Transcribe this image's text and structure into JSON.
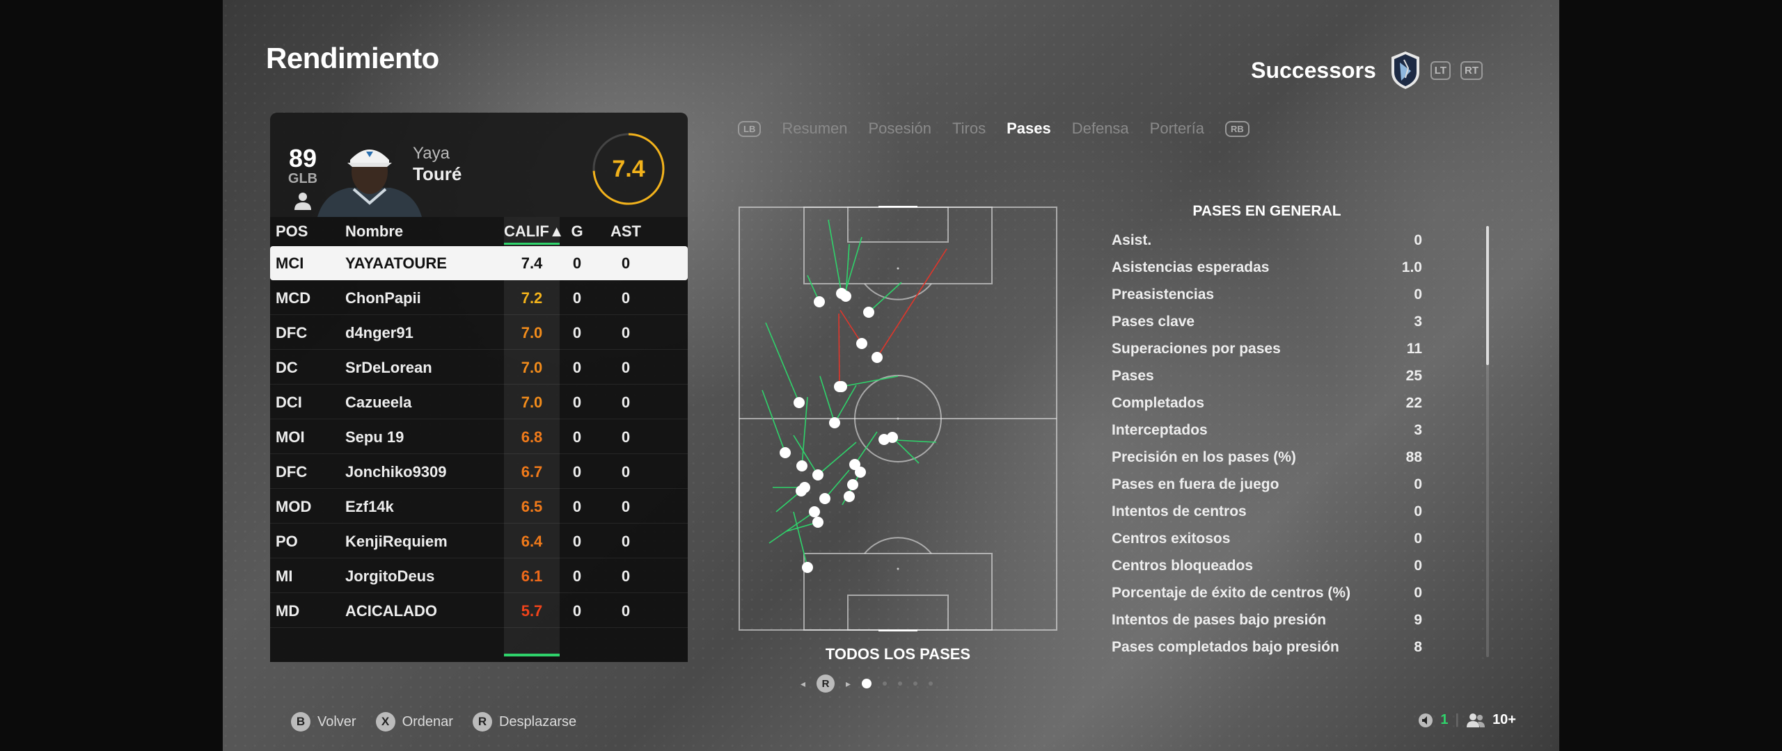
{
  "page": {
    "title": "Rendimiento"
  },
  "team": {
    "name": "Successors",
    "lt": "LT",
    "rt": "RT"
  },
  "player": {
    "overall": "89",
    "position": "GLB",
    "first_name": "Yaya",
    "last_name": "Touré",
    "rating": "7.4",
    "rating_fraction": 0.74
  },
  "table": {
    "headers": {
      "pos": "POS",
      "name": "Nombre",
      "calif": "CALIF▲",
      "g": "G",
      "ast": "AST"
    },
    "rows": [
      {
        "pos": "MCI",
        "name": "YAYAATOURE",
        "calif": "7.4",
        "g": "0",
        "ast": "0",
        "color": "#111111"
      },
      {
        "pos": "MCD",
        "name": "ChonPapii",
        "calif": "7.2",
        "g": "0",
        "ast": "0",
        "color": "#f2b21b"
      },
      {
        "pos": "DFC",
        "name": "d4nger91",
        "calif": "7.0",
        "g": "0",
        "ast": "0",
        "color": "#f28c1b"
      },
      {
        "pos": "DC",
        "name": "SrDeLorean",
        "calif": "7.0",
        "g": "0",
        "ast": "0",
        "color": "#f28c1b"
      },
      {
        "pos": "DCI",
        "name": "Cazueela",
        "calif": "7.0",
        "g": "0",
        "ast": "0",
        "color": "#f28c1b"
      },
      {
        "pos": "MOI",
        "name": "Sepu 19",
        "calif": "6.8",
        "g": "0",
        "ast": "0",
        "color": "#f07a1a"
      },
      {
        "pos": "DFC",
        "name": "Jonchiko9309",
        "calif": "6.7",
        "g": "0",
        "ast": "0",
        "color": "#f07a1a"
      },
      {
        "pos": "MOD",
        "name": "Ezf14k",
        "calif": "6.5",
        "g": "0",
        "ast": "0",
        "color": "#f07a1a"
      },
      {
        "pos": "PO",
        "name": "KenjiRequiem",
        "calif": "6.4",
        "g": "0",
        "ast": "0",
        "color": "#f07a1a"
      },
      {
        "pos": "MI",
        "name": "JorgitoDeus",
        "calif": "6.1",
        "g": "0",
        "ast": "0",
        "color": "#f06a1a"
      },
      {
        "pos": "MD",
        "name": "ACICALADO",
        "calif": "5.7",
        "g": "0",
        "ast": "0",
        "color": "#f0431a"
      }
    ]
  },
  "tabs": {
    "lb": "LB",
    "rb": "RB",
    "items": [
      "Resumen",
      "Posesión",
      "Tiros",
      "Pases",
      "Defensa",
      "Portería"
    ],
    "active_index": 3
  },
  "pitch": {
    "caption": "TODOS LOS PASES",
    "page_button": "R"
  },
  "stats": {
    "title": "PASES EN GENERAL",
    "items": [
      {
        "label": "Asist.",
        "value": "0"
      },
      {
        "label": "Asistencias esperadas",
        "value": "1.0"
      },
      {
        "label": "Preasistencias",
        "value": "0"
      },
      {
        "label": "Pases clave",
        "value": "3"
      },
      {
        "label": "Superaciones por pases",
        "value": "11"
      },
      {
        "label": "Pases",
        "value": "25"
      },
      {
        "label": "Completados",
        "value": "22"
      },
      {
        "label": "Interceptados",
        "value": "3"
      },
      {
        "label": "Precisión en los pases (%)",
        "value": "88"
      },
      {
        "label": "Pases en fuera de juego",
        "value": "0"
      },
      {
        "label": "Intentos de centros",
        "value": "0"
      },
      {
        "label": "Centros exitosos",
        "value": "0"
      },
      {
        "label": "Centros bloqueados",
        "value": "0"
      },
      {
        "label": "Porcentaje de éxito de centros (%)",
        "value": "0"
      },
      {
        "label": "Intentos de pases bajo presión",
        "value": "9"
      },
      {
        "label": "Pases completados bajo presión",
        "value": "8"
      }
    ]
  },
  "footer": {
    "back": {
      "key": "B",
      "label": "Volver"
    },
    "sort": {
      "key": "X",
      "label": "Ordenar"
    },
    "scroll": {
      "key": "R",
      "label": "Desplazarse"
    },
    "party_count": "1",
    "players_count": "10+"
  },
  "colors": {
    "accent_green": "#2fd36b",
    "rating_yellow": "#f2b21b",
    "pass_success": "#2fd36b",
    "pass_fail": "#e0362b"
  }
}
